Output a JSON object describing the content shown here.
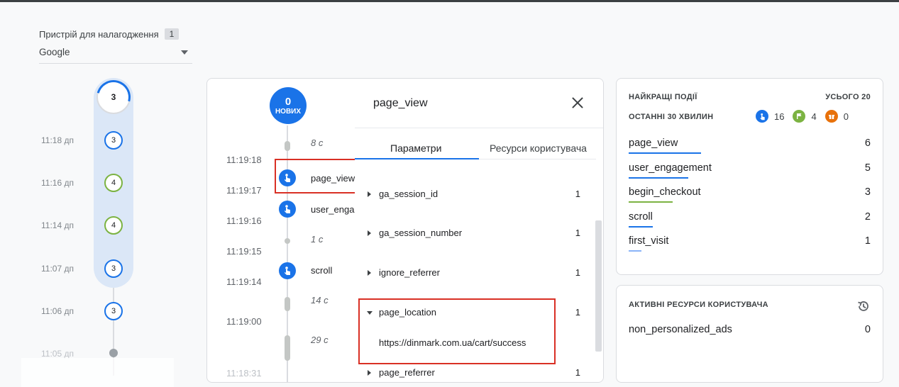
{
  "device": {
    "label": "Пристрій для налагодження",
    "count": "1",
    "selected": "Google"
  },
  "minutes": {
    "current": "3",
    "rows": [
      {
        "time": "11:18 дп",
        "count": "3",
        "color": "blue"
      },
      {
        "time": "11:16 дп",
        "count": "4",
        "color": "green"
      },
      {
        "time": "11:14 дп",
        "count": "4",
        "color": "green"
      },
      {
        "time": "11:07 дп",
        "count": "3",
        "color": "blue"
      },
      {
        "time": "11:06 дп",
        "count": "3",
        "color": "blue"
      },
      {
        "time": "11:05 дп",
        "count": "",
        "color": "gray"
      }
    ]
  },
  "stream": {
    "new_count": "0",
    "new_label": "НОВИХ",
    "times": [
      "11:19:18",
      "11:19:17",
      "11:19:16",
      "11:19:15",
      "11:19:14",
      "11:19:00",
      "11:18:31"
    ],
    "gaps": [
      "8 с",
      "1 с",
      "14 с",
      "29 с"
    ],
    "events": [
      {
        "name": "page_view"
      },
      {
        "name": "user_engagement"
      },
      {
        "name": "scroll"
      }
    ]
  },
  "detail": {
    "title": "page_view",
    "tabs": [
      "Параметри",
      "Ресурси користувача"
    ],
    "params": [
      {
        "name": "ga_session_id",
        "count": "1"
      },
      {
        "name": "ga_session_number",
        "count": "1"
      },
      {
        "name": "ignore_referrer",
        "count": "1"
      },
      {
        "name": "page_location",
        "count": "1",
        "value": "https://dinmark.com.ua/cart/success"
      },
      {
        "name": "page_referrer",
        "count": "1"
      }
    ]
  },
  "top_events": {
    "title": "НАЙКРАЩІ ПОДІЇ",
    "total": "УСЬОГО 20",
    "subtitle": "ОСТАННІ 30 ХВИЛИН",
    "legend": [
      {
        "icon": "touch-icon",
        "count": "16",
        "color": "#1a73e8"
      },
      {
        "icon": "flag-icon",
        "count": "4",
        "color": "#7cb342"
      },
      {
        "icon": "gift-icon",
        "count": "0",
        "color": "#e8710a"
      }
    ],
    "items": [
      {
        "name": "page_view",
        "value": "6",
        "share": 0.51,
        "color": "#1a73e8"
      },
      {
        "name": "user_engagement",
        "value": "5",
        "share": 0.42,
        "color": "#1a73e8"
      },
      {
        "name": "begin_checkout",
        "value": "3",
        "share": 0.31,
        "color": "#7cb342"
      },
      {
        "name": "scroll",
        "value": "2",
        "share": 0.17,
        "color": "#1a73e8"
      },
      {
        "name": "first_visit",
        "value": "1",
        "share": 0.09,
        "color": "#8ab4f8"
      }
    ]
  },
  "user_properties": {
    "title": "АКТИВНІ РЕСУРСИ КОРИСТУВАЧА",
    "items": [
      {
        "name": "non_personalized_ads",
        "value": "0"
      }
    ]
  }
}
